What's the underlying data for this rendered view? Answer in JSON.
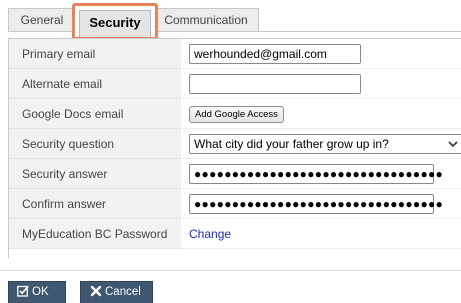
{
  "tabs": {
    "general": "General",
    "security": "Security",
    "communication": "Communication"
  },
  "form": {
    "primary_email": {
      "label": "Primary email",
      "value": "werhounded@gmail.com"
    },
    "alternate_email": {
      "label": "Alternate email",
      "value": ""
    },
    "google_docs_email": {
      "label": "Google Docs email",
      "button": "Add Google Access"
    },
    "security_question": {
      "label": "Security question",
      "selected": "What city did your father grow up in?"
    },
    "security_answer": {
      "label": "Security answer",
      "value": "●●●●●●●●●●●●●●●●●●●●●●●●●●●●●●●●●"
    },
    "confirm_answer": {
      "label": "Confirm answer",
      "value": "●●●●●●●●●●●●●●●●●●●●●●●●●●●●●●●●●"
    },
    "myeducation_password": {
      "label": "MyEducation BC Password",
      "link": "Change"
    }
  },
  "footer": {
    "ok": "OK",
    "cancel": "Cancel"
  },
  "icons": {
    "ok": "check-square-icon",
    "cancel": "x-icon",
    "select": "chevron-down-icon"
  },
  "colors": {
    "tab_highlight": "#e8835a",
    "footer_button": "#3f5770",
    "link": "#1a2fb0"
  }
}
